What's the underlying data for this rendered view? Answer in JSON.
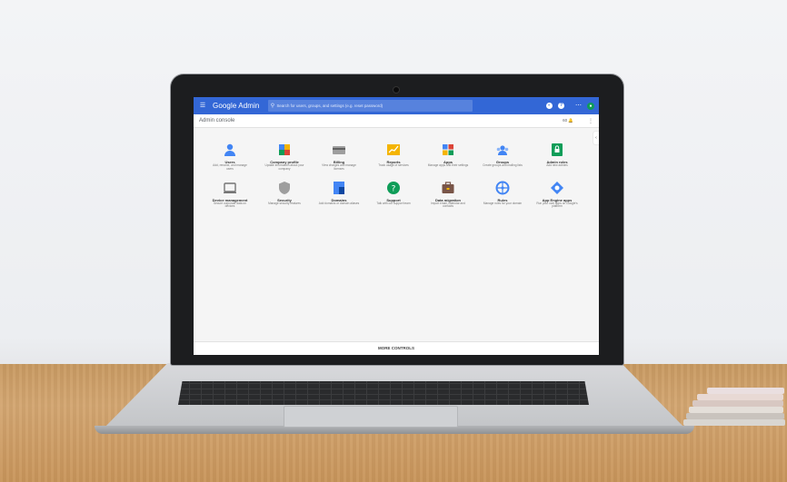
{
  "header": {
    "logo": "Google Admin",
    "search_placeholder": "Search for users, groups, and settings (e.g. reset password)"
  },
  "subbar": {
    "title": "Admin console",
    "notification_count": "60"
  },
  "tiles": [
    {
      "title": "Users",
      "desc": "Add, rename, and manage users",
      "icon": "users-icon",
      "color": "#4285f4"
    },
    {
      "title": "Company profile",
      "desc": "Update information about your company",
      "icon": "company-profile-icon",
      "color": "#f4b400"
    },
    {
      "title": "Billing",
      "desc": "View charges and manage licenses",
      "icon": "billing-icon",
      "color": "#9e9e9e"
    },
    {
      "title": "Reports",
      "desc": "Track usage of services",
      "icon": "reports-icon",
      "color": "#f4b400"
    },
    {
      "title": "Apps",
      "desc": "Manage apps and their settings",
      "icon": "apps-icon",
      "color": "#0f9d58"
    },
    {
      "title": "Groups",
      "desc": "Create groups and mailing lists",
      "icon": "groups-icon",
      "color": "#4285f4"
    },
    {
      "title": "Admin roles",
      "desc": "Add new admins",
      "icon": "admin-roles-icon",
      "color": "#0f9d58"
    },
    {
      "title": "Device management",
      "desc": "Secure corporate data on devices",
      "icon": "device-management-icon",
      "color": "#757575"
    },
    {
      "title": "Security",
      "desc": "Manage security features",
      "icon": "security-icon",
      "color": "#9e9e9e"
    },
    {
      "title": "Domains",
      "desc": "Add domains or domain aliases",
      "icon": "domains-icon",
      "color": "#4285f4"
    },
    {
      "title": "Support",
      "desc": "Talk with our support team",
      "icon": "support-icon",
      "color": "#0f9d58"
    },
    {
      "title": "Data migration",
      "desc": "Import email, calendar and contacts",
      "icon": "data-migration-icon",
      "color": "#795548"
    },
    {
      "title": "Rules",
      "desc": "Manage rules for your domain",
      "icon": "rules-icon",
      "color": "#4285f4"
    },
    {
      "title": "App Engine apps",
      "desc": "Run your own apps on Google's platform",
      "icon": "app-engine-icon",
      "color": "#4285f4"
    }
  ],
  "footer": {
    "more_controls_label": "MORE CONTROLS"
  },
  "colors": {
    "topbar": "#3367d6",
    "avatar": "#0f9d58"
  }
}
